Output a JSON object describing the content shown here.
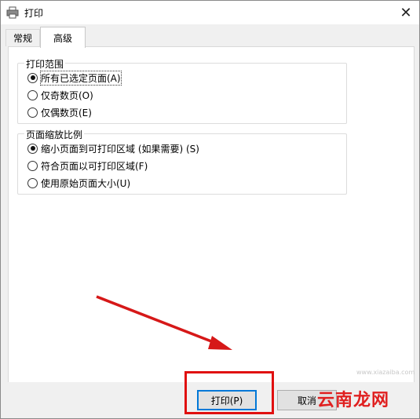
{
  "window": {
    "title": "打印"
  },
  "tabs": [
    {
      "label": "常规",
      "active": false
    },
    {
      "label": "高级",
      "active": true
    }
  ],
  "print_range": {
    "legend": "打印范围",
    "options": [
      {
        "label": "所有已选定页面(A)",
        "selected": true
      },
      {
        "label": "仅奇数页(O)",
        "selected": false
      },
      {
        "label": "仅偶数页(E)",
        "selected": false
      }
    ]
  },
  "page_scaling": {
    "legend": "页面缩放比例",
    "options": [
      {
        "label": "缩小页面到可打印区域 (如果需要) (S)",
        "selected": true
      },
      {
        "label": "符合页面以可打印区域(F)",
        "selected": false
      },
      {
        "label": "使用原始页面大小(U)",
        "selected": false
      }
    ]
  },
  "buttons": {
    "print": "打印(P)",
    "cancel": "取消"
  },
  "watermark": {
    "text": "云南龙网",
    "sub": "www.xiazaiba.com"
  },
  "colors": {
    "highlight": "#e01010",
    "focus": "#0078d7"
  }
}
